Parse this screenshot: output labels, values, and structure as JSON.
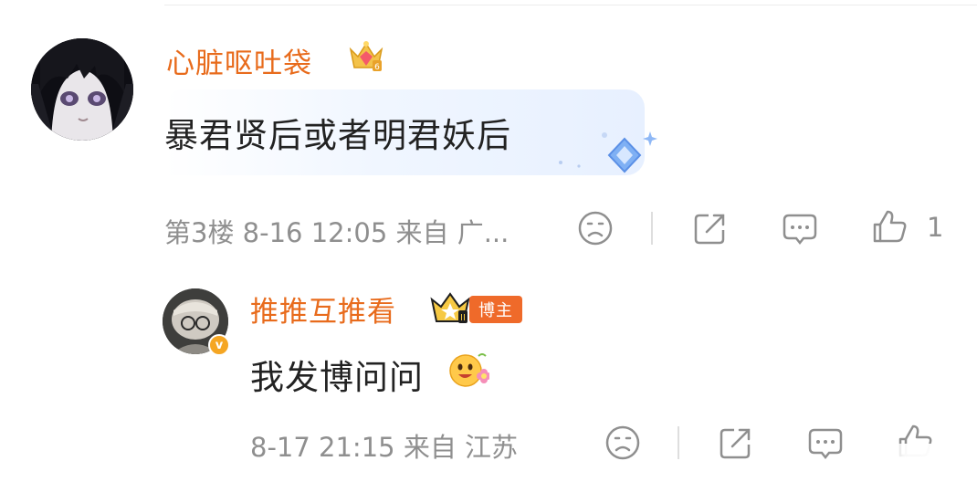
{
  "comments": [
    {
      "username": "心脏呕吐袋",
      "content": "暴君贤后或者明君妖后",
      "meta": "第3楼 8-16 12:05 来自 广...",
      "like_count": "1",
      "badge_icon": "diamond-crown-icon",
      "colors": {
        "username": "#e86b1c",
        "bubble": "#e7f0ff"
      }
    },
    {
      "username": "推推互推看",
      "role_tag": "博主",
      "content": "我发博问问",
      "meta": "8-17 21:15 来自 江苏",
      "badge_icon": "gold-crown-icon",
      "verified_badge": "v",
      "emoji_icon": "flower-face-emoji-icon",
      "colors": {
        "username": "#e86b1c",
        "tag": "#ef6a2a",
        "verified": "#f5a623"
      }
    }
  ],
  "actions": [
    "dislike-face-icon",
    "share-icon",
    "comment-icon",
    "like-thumb-icon"
  ]
}
